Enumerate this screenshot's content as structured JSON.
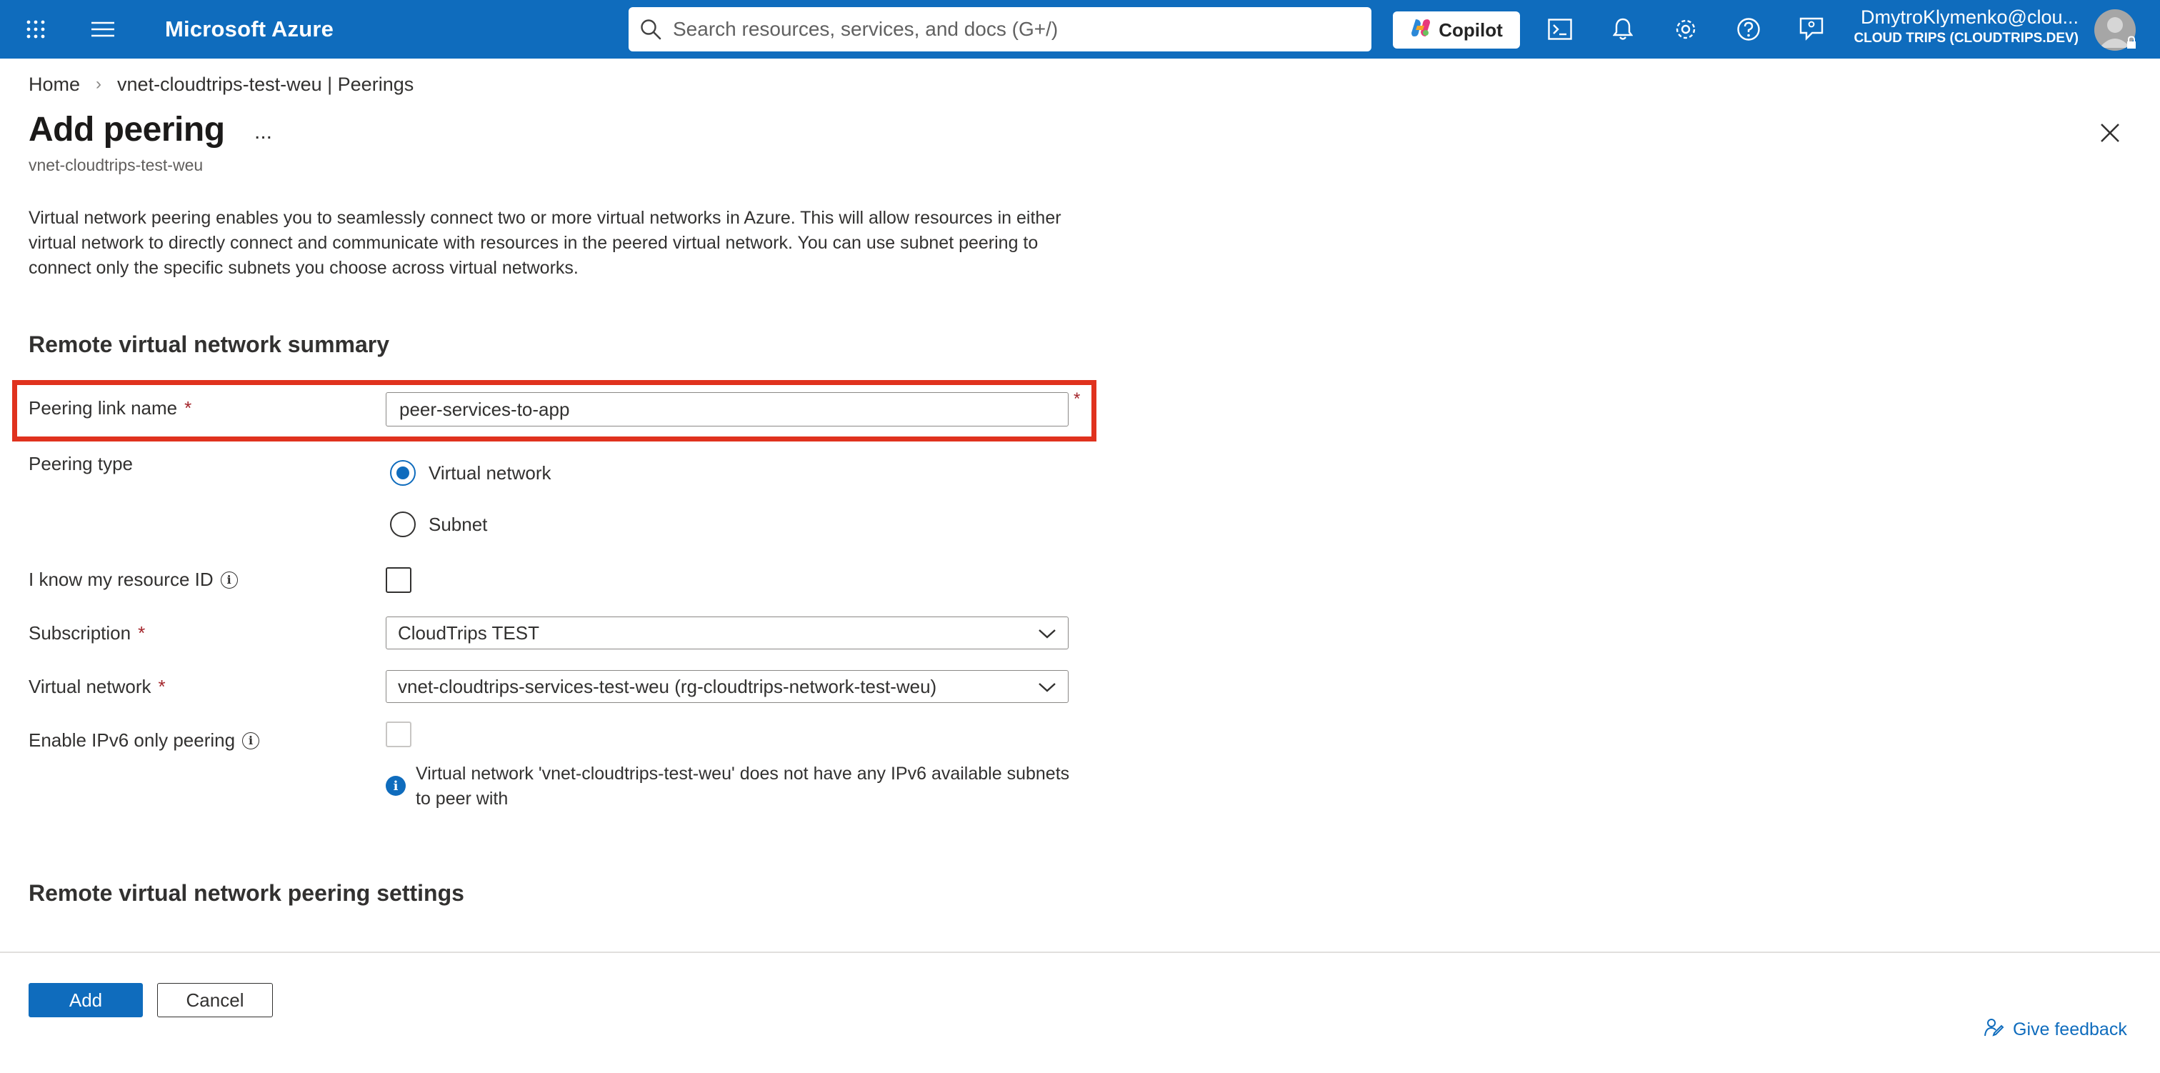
{
  "topbar": {
    "brand": "Microsoft Azure",
    "search_placeholder": "Search resources, services, and docs (G+/)",
    "copilot_label": "Copilot",
    "account_name": "DmytroKlymenko@clou...",
    "account_directory": "CLOUD TRIPS (CLOUDTRIPS.DEV)",
    "icons": [
      "app-launcher-icon",
      "hamburger-menu-icon",
      "cloud-shell-icon",
      "notifications-bell-icon",
      "settings-gear-icon",
      "help-question-icon",
      "feedback-person-icon"
    ]
  },
  "breadcrumb": {
    "home": "Home",
    "parent": "vnet-cloudtrips-test-weu | Peerings"
  },
  "header": {
    "title": "Add peering",
    "more": "...",
    "subtitle": "vnet-cloudtrips-test-weu"
  },
  "description": "Virtual network peering enables you to seamlessly connect two or more virtual networks in Azure. This will allow resources in either virtual network to directly connect and communicate with resources in the peered virtual network. You can use subnet peering to connect only the specific subnets you choose across virtual networks.",
  "remote_summary": {
    "heading": "Remote virtual network summary",
    "peering_link_name_label": "Peering link name",
    "peering_link_name_value": "peer-services-to-app",
    "required_mark": "*",
    "peering_type_label": "Peering type",
    "peering_type_options": [
      "Virtual network",
      "Subnet"
    ],
    "peering_type_selected": "Virtual network",
    "resource_id_label": "I know my resource ID",
    "resource_id_checked": false,
    "subscription_label": "Subscription",
    "subscription_value": "CloudTrips TEST",
    "virtual_network_label": "Virtual network",
    "virtual_network_value": "vnet-cloudtrips-services-test-weu (rg-cloudtrips-network-test-weu)",
    "ipv6_label": "Enable IPv6 only peering",
    "ipv6_checked": false,
    "ipv6_disabled": true,
    "ipv6_info": "Virtual network 'vnet-cloudtrips-test-weu' does not have any IPv6 available subnets to peer with"
  },
  "remote_settings": {
    "heading": "Remote virtual network peering settings"
  },
  "footer": {
    "add_label": "Add",
    "cancel_label": "Cancel",
    "feedback_label": "Give feedback"
  },
  "colors": {
    "accent": "#0f6cbd",
    "highlight_border": "#e0321e",
    "required": "#a4262c"
  }
}
